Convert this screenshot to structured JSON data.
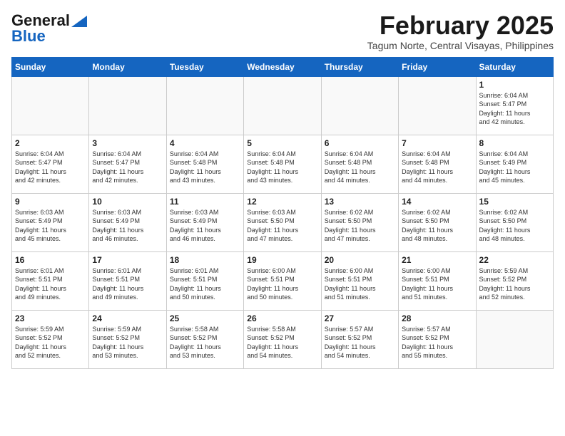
{
  "header": {
    "logo_general": "General",
    "logo_blue": "Blue",
    "month_year": "February 2025",
    "location": "Tagum Norte, Central Visayas, Philippines"
  },
  "calendar": {
    "days_of_week": [
      "Sunday",
      "Monday",
      "Tuesday",
      "Wednesday",
      "Thursday",
      "Friday",
      "Saturday"
    ],
    "weeks": [
      [
        {
          "day": "",
          "info": ""
        },
        {
          "day": "",
          "info": ""
        },
        {
          "day": "",
          "info": ""
        },
        {
          "day": "",
          "info": ""
        },
        {
          "day": "",
          "info": ""
        },
        {
          "day": "",
          "info": ""
        },
        {
          "day": "1",
          "info": "Sunrise: 6:04 AM\nSunset: 5:47 PM\nDaylight: 11 hours\nand 42 minutes."
        }
      ],
      [
        {
          "day": "2",
          "info": "Sunrise: 6:04 AM\nSunset: 5:47 PM\nDaylight: 11 hours\nand 42 minutes."
        },
        {
          "day": "3",
          "info": "Sunrise: 6:04 AM\nSunset: 5:47 PM\nDaylight: 11 hours\nand 42 minutes."
        },
        {
          "day": "4",
          "info": "Sunrise: 6:04 AM\nSunset: 5:48 PM\nDaylight: 11 hours\nand 43 minutes."
        },
        {
          "day": "5",
          "info": "Sunrise: 6:04 AM\nSunset: 5:48 PM\nDaylight: 11 hours\nand 43 minutes."
        },
        {
          "day": "6",
          "info": "Sunrise: 6:04 AM\nSunset: 5:48 PM\nDaylight: 11 hours\nand 44 minutes."
        },
        {
          "day": "7",
          "info": "Sunrise: 6:04 AM\nSunset: 5:48 PM\nDaylight: 11 hours\nand 44 minutes."
        },
        {
          "day": "8",
          "info": "Sunrise: 6:04 AM\nSunset: 5:49 PM\nDaylight: 11 hours\nand 45 minutes."
        }
      ],
      [
        {
          "day": "9",
          "info": "Sunrise: 6:03 AM\nSunset: 5:49 PM\nDaylight: 11 hours\nand 45 minutes."
        },
        {
          "day": "10",
          "info": "Sunrise: 6:03 AM\nSunset: 5:49 PM\nDaylight: 11 hours\nand 46 minutes."
        },
        {
          "day": "11",
          "info": "Sunrise: 6:03 AM\nSunset: 5:49 PM\nDaylight: 11 hours\nand 46 minutes."
        },
        {
          "day": "12",
          "info": "Sunrise: 6:03 AM\nSunset: 5:50 PM\nDaylight: 11 hours\nand 47 minutes."
        },
        {
          "day": "13",
          "info": "Sunrise: 6:02 AM\nSunset: 5:50 PM\nDaylight: 11 hours\nand 47 minutes."
        },
        {
          "day": "14",
          "info": "Sunrise: 6:02 AM\nSunset: 5:50 PM\nDaylight: 11 hours\nand 48 minutes."
        },
        {
          "day": "15",
          "info": "Sunrise: 6:02 AM\nSunset: 5:50 PM\nDaylight: 11 hours\nand 48 minutes."
        }
      ],
      [
        {
          "day": "16",
          "info": "Sunrise: 6:01 AM\nSunset: 5:51 PM\nDaylight: 11 hours\nand 49 minutes."
        },
        {
          "day": "17",
          "info": "Sunrise: 6:01 AM\nSunset: 5:51 PM\nDaylight: 11 hours\nand 49 minutes."
        },
        {
          "day": "18",
          "info": "Sunrise: 6:01 AM\nSunset: 5:51 PM\nDaylight: 11 hours\nand 50 minutes."
        },
        {
          "day": "19",
          "info": "Sunrise: 6:00 AM\nSunset: 5:51 PM\nDaylight: 11 hours\nand 50 minutes."
        },
        {
          "day": "20",
          "info": "Sunrise: 6:00 AM\nSunset: 5:51 PM\nDaylight: 11 hours\nand 51 minutes."
        },
        {
          "day": "21",
          "info": "Sunrise: 6:00 AM\nSunset: 5:51 PM\nDaylight: 11 hours\nand 51 minutes."
        },
        {
          "day": "22",
          "info": "Sunrise: 5:59 AM\nSunset: 5:52 PM\nDaylight: 11 hours\nand 52 minutes."
        }
      ],
      [
        {
          "day": "23",
          "info": "Sunrise: 5:59 AM\nSunset: 5:52 PM\nDaylight: 11 hours\nand 52 minutes."
        },
        {
          "day": "24",
          "info": "Sunrise: 5:59 AM\nSunset: 5:52 PM\nDaylight: 11 hours\nand 53 minutes."
        },
        {
          "day": "25",
          "info": "Sunrise: 5:58 AM\nSunset: 5:52 PM\nDaylight: 11 hours\nand 53 minutes."
        },
        {
          "day": "26",
          "info": "Sunrise: 5:58 AM\nSunset: 5:52 PM\nDaylight: 11 hours\nand 54 minutes."
        },
        {
          "day": "27",
          "info": "Sunrise: 5:57 AM\nSunset: 5:52 PM\nDaylight: 11 hours\nand 54 minutes."
        },
        {
          "day": "28",
          "info": "Sunrise: 5:57 AM\nSunset: 5:52 PM\nDaylight: 11 hours\nand 55 minutes."
        },
        {
          "day": "",
          "info": ""
        }
      ]
    ]
  }
}
